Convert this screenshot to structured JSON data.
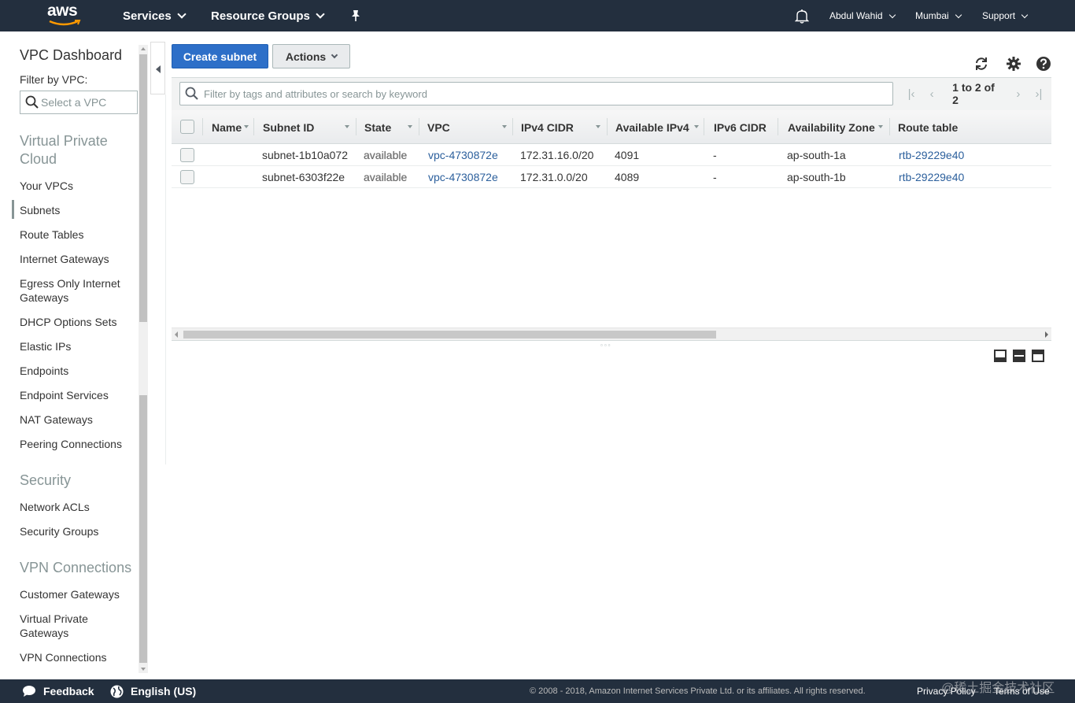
{
  "header": {
    "logo_text": "aws",
    "services_label": "Services",
    "resource_groups_label": "Resource Groups",
    "user_label": "Abdul Wahid",
    "region_label": "Mumbai",
    "support_label": "Support",
    "colors": {
      "nav_bg": "#232f3e",
      "primary_button": "#2d6fc8",
      "link": "#2b5f9c"
    }
  },
  "sidebar": {
    "title": "VPC Dashboard",
    "filter_label": "Filter by VPC:",
    "vpc_placeholder": "Select a VPC",
    "active_item": "Subnets",
    "sections": [
      {
        "title": "Virtual Private Cloud",
        "items": [
          "Your VPCs",
          "Subnets",
          "Route Tables",
          "Internet Gateways",
          "Egress Only Internet Gateways",
          "DHCP Options Sets",
          "Elastic IPs",
          "Endpoints",
          "Endpoint Services",
          "NAT Gateways",
          "Peering Connections"
        ]
      },
      {
        "title": "Security",
        "items": [
          "Network ACLs",
          "Security Groups"
        ]
      },
      {
        "title": "VPN Connections",
        "items": [
          "Customer Gateways",
          "Virtual Private Gateways",
          "VPN Connections"
        ]
      }
    ]
  },
  "toolbar": {
    "create_label": "Create subnet",
    "actions_label": "Actions",
    "icons": [
      "refresh-icon",
      "gear-icon",
      "help-icon"
    ]
  },
  "filter": {
    "placeholder": "Filter by tags and attributes or search by keyword",
    "pagination_text": "1 to 2 of 2"
  },
  "table": {
    "columns": [
      "Name",
      "Subnet ID",
      "State",
      "VPC",
      "IPv4 CIDR",
      "Available IPv4",
      "IPv6 CIDR",
      "Availability Zone",
      "Route table"
    ],
    "rows": [
      {
        "name": "",
        "subnet_id": "subnet-1b10a072",
        "state": "available",
        "vpc": "vpc-4730872e",
        "ipv4_cidr": "172.31.16.0/20",
        "available_ipv4": "4091",
        "ipv6_cidr": "-",
        "az": "ap-south-1a",
        "route_table": "rtb-29229e40"
      },
      {
        "name": "",
        "subnet_id": "subnet-6303f22e",
        "state": "available",
        "vpc": "vpc-4730872e",
        "ipv4_cidr": "172.31.0.0/20",
        "available_ipv4": "4089",
        "ipv6_cidr": "-",
        "az": "ap-south-1b",
        "route_table": "rtb-29229e40"
      }
    ]
  },
  "footer": {
    "feedback_label": "Feedback",
    "language_label": "English (US)",
    "copyright": "© 2008 - 2018, Amazon Internet Services Private Ltd. or its affiliates. All rights reserved.",
    "privacy_label": "Privacy Policy",
    "terms_label": "Terms of Use",
    "watermark": "@稀土掘金技术社区"
  }
}
